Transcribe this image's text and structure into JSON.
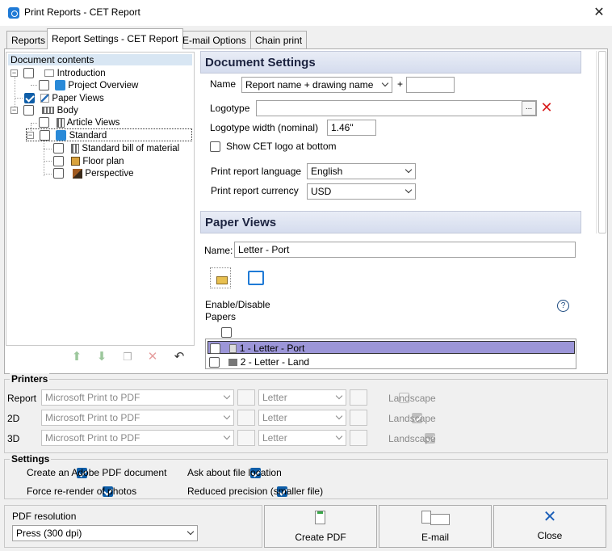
{
  "window": {
    "title": "Print Reports - CET Report",
    "close_glyph": "✕"
  },
  "tabs": [
    {
      "label": "Reports"
    },
    {
      "label": "Report Settings - CET Report"
    },
    {
      "label": "E-mail Options"
    },
    {
      "label": "Chain print"
    }
  ],
  "tree": {
    "header": "Document contents",
    "nodes": [
      {
        "label": "Introduction",
        "checked": false,
        "icon": "document-icon",
        "expander": "minus"
      },
      {
        "label": "Project Overview",
        "checked": false,
        "icon": "cet-icon"
      },
      {
        "label": "Paper Views",
        "checked": true,
        "icon": "pen-icon"
      },
      {
        "label": "Body",
        "checked": false,
        "icon": "grid-icon",
        "expander": "minus"
      },
      {
        "label": "Article Views",
        "checked": false,
        "icon": "grid-icon"
      },
      {
        "label": "Standard",
        "checked": false,
        "icon": "cet-icon",
        "expander": "minus"
      },
      {
        "label": "Standard bill of material",
        "checked": false,
        "icon": "grid-icon"
      },
      {
        "label": "Floor plan",
        "checked": false,
        "icon": "floor-plan-icon"
      },
      {
        "label": "Perspective",
        "checked": false,
        "icon": "box-icon"
      }
    ],
    "tools": [
      "move-up-icon",
      "move-down-icon",
      "copy-icon",
      "delete-icon",
      "undo-icon"
    ]
  },
  "document_settings": {
    "header": "Document Settings",
    "name_label": "Name",
    "name_select": "Report name + drawing name",
    "plus": "+",
    "name_suffix": "",
    "logotype_label": "Logotype",
    "logotype_value": "",
    "browse_label": "...",
    "logotype_width_label": "Logotype width (nominal)",
    "logotype_width_value": "1.46\"",
    "show_cet_logo_label": "Show CET logo at bottom",
    "show_cet_logo": false,
    "language_label": "Print report language",
    "language_value": "English",
    "currency_label": "Print report currency",
    "currency_value": "USD"
  },
  "paper_views": {
    "header": "Paper Views",
    "name_label": "Name:",
    "name_value": "Letter - Port",
    "enable_label_1": "Enable/Disable",
    "enable_label_2": "Papers",
    "help": "?",
    "papers": [
      {
        "label": "1 - Letter - Port",
        "selected": true
      },
      {
        "label": "2 - Letter - Land",
        "selected": false
      }
    ]
  },
  "printers": {
    "title": "Printers",
    "rows": [
      {
        "label": "Report",
        "printer": "Microsoft Print to PDF",
        "paper": "Letter",
        "landscape_label": "Landscape",
        "landscape": false
      },
      {
        "label": "2D",
        "printer": "Microsoft Print to PDF",
        "paper": "Letter",
        "landscape_label": "Landscape",
        "landscape": true
      },
      {
        "label": "3D",
        "printer": "Microsoft Print to PDF",
        "paper": "Letter",
        "landscape_label": "Landscape",
        "landscape": true
      }
    ]
  },
  "settings": {
    "title": "Settings",
    "create_pdf_label": "Create an Adobe PDF document",
    "ask_location_label": "Ask about file location",
    "rerender_label": "Force re-render of photos",
    "reduced_precision_label": "Reduced precision (smaller file)"
  },
  "pdf": {
    "label": "PDF resolution",
    "value": "Press (300 dpi)"
  },
  "buttons": {
    "create_pdf": "Create PDF",
    "email": "E-mail",
    "close": "Close"
  },
  "colors": {
    "accent": "#0f5ea8",
    "selection": "#9c96d8",
    "section_header_text": "#1c2340"
  }
}
